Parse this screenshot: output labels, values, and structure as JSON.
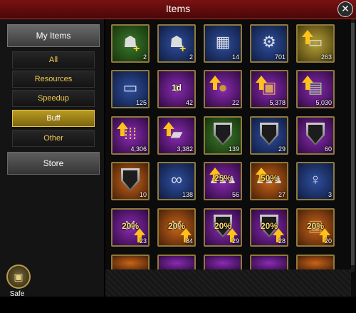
{
  "header": {
    "title": "Items",
    "close_glyph": "✕"
  },
  "sidebar": {
    "my_items_label": "My Items",
    "categories": [
      {
        "label": "All",
        "active": false
      },
      {
        "label": "Resources",
        "active": false
      },
      {
        "label": "Speedup",
        "active": false
      },
      {
        "label": "Buff",
        "active": true
      },
      {
        "label": "Other",
        "active": false
      }
    ],
    "store_label": "Store",
    "safe_label": "Safe"
  },
  "items": [
    {
      "name": "hooded-figure-plus",
      "bg": "green",
      "count": "2"
    },
    {
      "name": "hooded-figure-plus",
      "bg": "blue",
      "count": "2"
    },
    {
      "name": "barricade",
      "bg": "blue",
      "count": "14"
    },
    {
      "name": "motorcycle",
      "bg": "blue",
      "count": "701"
    },
    {
      "name": "map-arrow",
      "bg": "gold",
      "count": "263"
    },
    {
      "name": "map-question",
      "bg": "blue",
      "count": "125"
    },
    {
      "name": "coin-1d",
      "bg": "purple",
      "text": "1d",
      "count": "42"
    },
    {
      "name": "coin-arrow",
      "bg": "purple",
      "count": "22"
    },
    {
      "name": "crate-arrow",
      "bg": "purple",
      "count": "5,378"
    },
    {
      "name": "cash-arrow",
      "bg": "purple",
      "count": "5,030"
    },
    {
      "name": "ammo-arrow",
      "bg": "purple",
      "count": "4,306"
    },
    {
      "name": "ingots-arrow",
      "bg": "purple",
      "count": "3,382"
    },
    {
      "name": "mafia-shield",
      "bg": "green",
      "count": "139"
    },
    {
      "name": "mafia-shield",
      "bg": "blue",
      "count": "29"
    },
    {
      "name": "mafia-shield",
      "bg": "purple",
      "count": "60"
    },
    {
      "name": "mafia-shield",
      "bg": "orange",
      "count": "10"
    },
    {
      "name": "binoculars-no",
      "bg": "blue",
      "count": "138"
    },
    {
      "name": "troops-25",
      "bg": "purple",
      "text": "25%",
      "count": "56"
    },
    {
      "name": "troops-50",
      "bg": "orange",
      "text": "50%",
      "count": "27"
    },
    {
      "name": "woman-envelope",
      "bg": "blue",
      "count": "3"
    },
    {
      "name": "rifles-20",
      "bg": "purple",
      "text": "20%",
      "count": "23"
    },
    {
      "name": "rifles-20",
      "bg": "orange",
      "text": "20%",
      "count": "84"
    },
    {
      "name": "shield-20",
      "bg": "purple",
      "text": "20%",
      "count": "29"
    },
    {
      "name": "shield-20",
      "bg": "purple",
      "text": "20%",
      "count": "28"
    },
    {
      "name": "crate-20",
      "bg": "orange",
      "text": "20%",
      "count": "20"
    },
    {
      "name": "partial-item",
      "bg": "orange",
      "count": ""
    },
    {
      "name": "partial-item",
      "bg": "purple",
      "count": ""
    },
    {
      "name": "partial-item",
      "bg": "purple",
      "count": ""
    },
    {
      "name": "partial-item",
      "bg": "purple",
      "count": ""
    },
    {
      "name": "partial-item",
      "bg": "orange",
      "count": ""
    }
  ]
}
